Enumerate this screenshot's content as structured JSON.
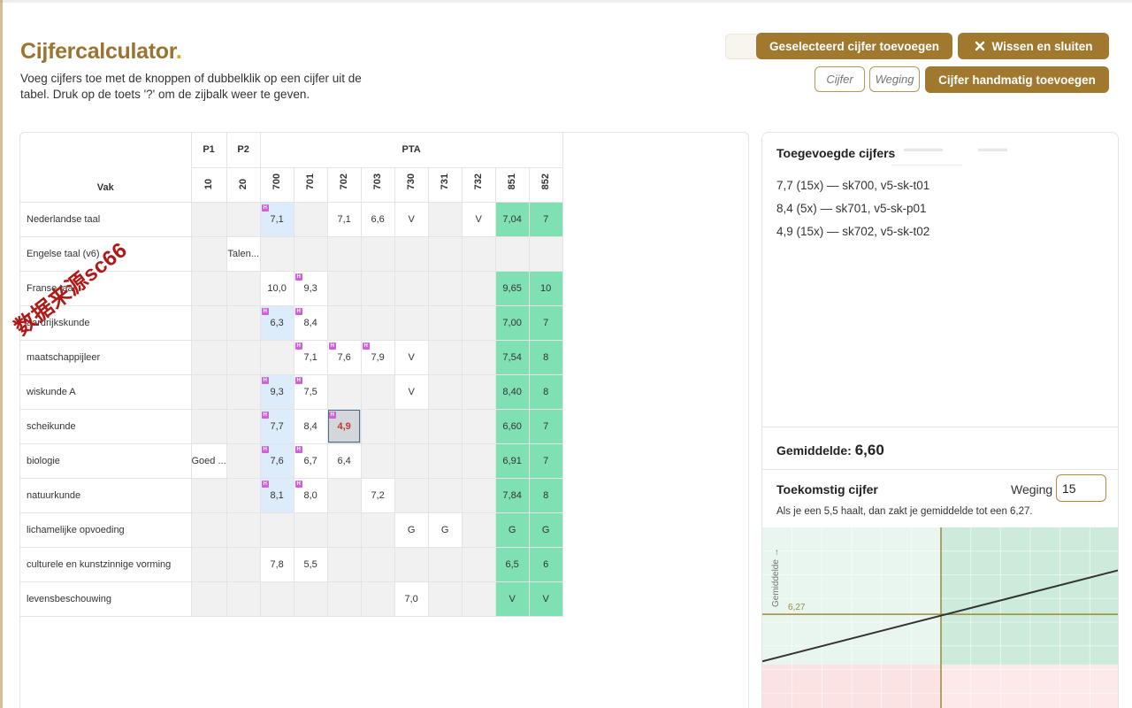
{
  "page": {
    "title": "Cijfercalculator",
    "title_dot": ".",
    "subtitle": "Voeg cijfers toe met de knoppen of dubbelklik op een cijfer uit de tabel. Druk op de toets '?' om de zijbalk weer te geven."
  },
  "toolbar": {
    "add_selected_label": "Geselecteerd cijfer toevoegen",
    "clear_close_label": "Wissen en sluiten",
    "grade_placeholder": "Cijfer",
    "weight_placeholder": "Weging",
    "add_manual_label": "Cijfer handmatig toevoegen"
  },
  "colors": {
    "accent": "#a0782e",
    "green": "#7fe0b4",
    "blue": "#dcecfb",
    "flag": "#d060d8"
  },
  "table": {
    "groups": {
      "vak": "Vak",
      "p1": "P1",
      "p2": "P2",
      "pta": "PTA"
    },
    "codes": [
      "10",
      "20",
      "700",
      "701",
      "702",
      "703",
      "730",
      "731",
      "732",
      "851",
      "852"
    ],
    "rows": [
      {
        "subject": "Nederlandse taal",
        "cells": [
          "",
          "",
          "7,1",
          "",
          "7,1",
          "6,6",
          "V",
          "",
          "V",
          "7,04",
          "7"
        ]
      },
      {
        "subject": "Engelse taal (v6)",
        "cells": [
          "",
          "Talen...",
          "",
          "",
          "",
          "",
          "",
          "",
          "",
          "",
          ""
        ]
      },
      {
        "subject": "Franse taal",
        "cells": [
          "",
          "",
          "10,0",
          "9,3",
          "",
          "",
          "",
          "",
          "",
          "9,65",
          "10"
        ]
      },
      {
        "subject": "aardrijkskunde",
        "cells": [
          "",
          "",
          "6,3",
          "8,4",
          "",
          "",
          "",
          "",
          "",
          "7,00",
          "7"
        ]
      },
      {
        "subject": "maatschappijleer",
        "cells": [
          "",
          "",
          "",
          "7,1",
          "7,6",
          "7,9",
          "V",
          "",
          "",
          "7,54",
          "8"
        ]
      },
      {
        "subject": "wiskunde A",
        "cells": [
          "",
          "",
          "9,3",
          "7,5",
          "",
          "",
          "V",
          "",
          "",
          "8,40",
          "8"
        ]
      },
      {
        "subject": "scheikunde",
        "cells": [
          "",
          "",
          "7,7",
          "8,4",
          "4,9",
          "",
          "",
          "",
          "",
          "6,60",
          "7"
        ]
      },
      {
        "subject": "biologie",
        "cells": [
          "Goed ...",
          "",
          "7,6",
          "6,7",
          "6,4",
          "",
          "",
          "",
          "",
          "6,91",
          "7"
        ]
      },
      {
        "subject": "natuurkunde",
        "cells": [
          "",
          "",
          "8,1",
          "8,0",
          "",
          "7,2",
          "",
          "",
          "",
          "7,84",
          "8"
        ]
      },
      {
        "subject": "lichamelijke opvoeding",
        "cells": [
          "",
          "",
          "",
          "",
          "",
          "",
          "G",
          "G",
          "",
          "G",
          "G"
        ]
      },
      {
        "subject": "culturele en kunstzinnige vorming",
        "cells": [
          "",
          "",
          "7,8",
          "5,5",
          "",
          "",
          "",
          "",
          "",
          "6,5",
          "6"
        ]
      },
      {
        "subject": "levensbeschouwing",
        "cells": [
          "",
          "",
          "",
          "",
          "",
          "",
          "7,0",
          "",
          "",
          "V",
          "V"
        ]
      }
    ],
    "flag_label": "H"
  },
  "sidebar": {
    "added_title": "Toegevoegde cijfers",
    "added_items": [
      "7,7 (15x) — sk700, v5-sk-t01",
      "8,4 (5x) — sk701, v5-sk-p01",
      "4,9 (15x) — sk702, v5-sk-t02"
    ],
    "average_label": "Gemiddelde:",
    "average_value": "6,60",
    "future_title": "Toekomstig cijfer",
    "weight_label": "Weging",
    "weight_value": "15",
    "future_note": "Als je een 5,5 haalt, dan zakt je gemiddelde tot een 6,27.",
    "chart_ylabel": "Gemiddelde →",
    "chart_marker_label": "6,27"
  },
  "chart_data": {
    "type": "line",
    "title": "",
    "xlabel": "",
    "ylabel": "Gemiddelde →",
    "x": [
      1,
      10
    ],
    "series": [
      {
        "values": [
          5.55,
          6.95
        ]
      }
    ],
    "crosshair": {
      "x": 5.5,
      "y": 6.27,
      "label": "6,27"
    },
    "pass_threshold": 5.5,
    "ylim": [
      4.7,
      7.6
    ],
    "xlim": [
      1,
      10
    ],
    "grid": true
  },
  "watermark": "数据来源sc66"
}
